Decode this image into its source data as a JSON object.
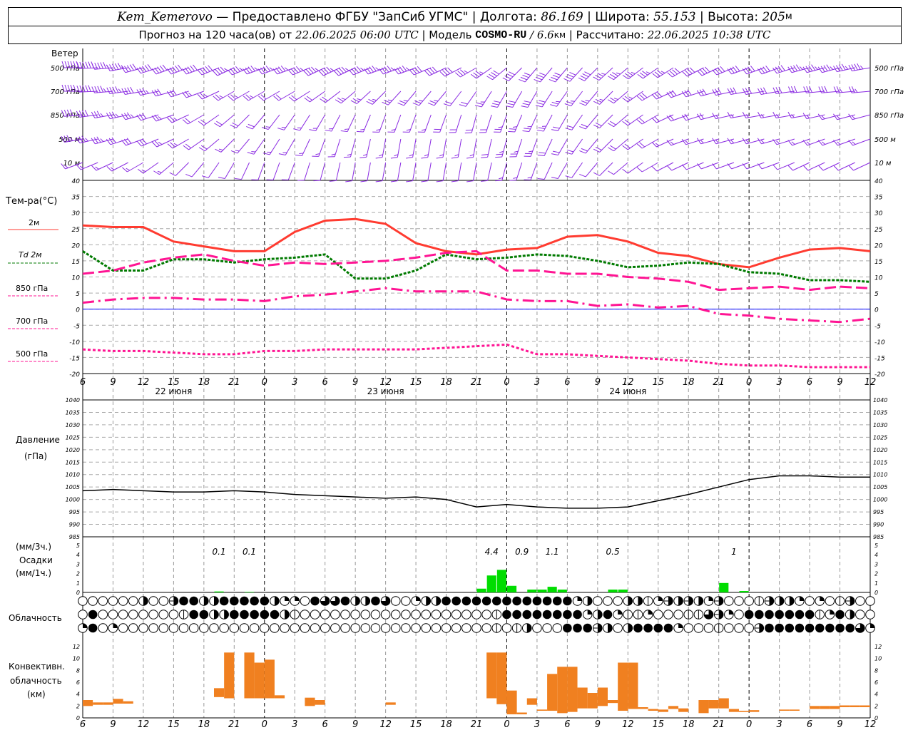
{
  "header": {
    "station": "Kem_Kemerovo",
    "provided": " — Предоставлено ФГБУ \"ЗапСиб УГМС\" | Долгота: ",
    "lon": "86.169",
    "lat_label": " | Широта: ",
    "lat": "55.153",
    "alt_label": " | Высота: ",
    "alt": "205",
    "alt_unit": "м",
    "forecast_label": "Прогноз на 120 часа(ов) от ",
    "forecast_time": "22.06.2025 06:00 UTC",
    "model_label": " | Модель ",
    "model": "COSMO-RU",
    "model_res": " / 6.6",
    "res_unit": "км",
    "calc_label": " | Рассчитано: ",
    "calc_time": "22.06.2025 10:38 UTC"
  },
  "labels": {
    "wind": "Ветер",
    "wind_levels": [
      "500 гПа",
      "700 гПа",
      "850 гПа",
      "500 м",
      "10 м"
    ],
    "temp": "Тем-ра(°C)",
    "t2m": "2м",
    "td": "Td  2м",
    "t850": "850 гПа",
    "t700": "700 гПа",
    "t500": "500 гПа",
    "pressure": "Давление",
    "pressure_unit": "(гПа)",
    "precip_unit3": "(мм/3ч.)",
    "precip": "Осадки",
    "precip_unit1": "(мм/1ч.)",
    "cloud": "Облачность",
    "conv1": "Конвективн.",
    "conv2": "облачность",
    "conv3": "(км)"
  },
  "colors": {
    "t2m": "#ff3b30",
    "td": "#007a00",
    "levels": "#ff1493",
    "wind": "#8a2be2",
    "precip": "#00dd00",
    "conv": "#f08020",
    "zero": "#0000ff"
  },
  "chart_data": {
    "type": "line",
    "x_hours_from_start": [
      0,
      3,
      6,
      9,
      12,
      15,
      18,
      21,
      24,
      27,
      30,
      33,
      36,
      39,
      42,
      45,
      48,
      51,
      54,
      57,
      60,
      63,
      66,
      69,
      72,
      75,
      78
    ],
    "x_tick_labels": [
      "6",
      "9",
      "12",
      "15",
      "18",
      "21",
      "0",
      "3",
      "6",
      "9",
      "12",
      "15",
      "18",
      "21",
      "0",
      "3",
      "6",
      "9",
      "12",
      "15",
      "18",
      "21",
      "0",
      "3",
      "6",
      "9",
      "12"
    ],
    "day_labels": [
      {
        "label": "22 июня",
        "hour": 9
      },
      {
        "label": "23 июня",
        "hour": 30
      },
      {
        "label": "24 июня",
        "hour": 54
      }
    ],
    "temperature": {
      "ylim": [
        -20,
        40
      ],
      "yticks": [
        40,
        35,
        30,
        25,
        20,
        15,
        10,
        5,
        0,
        -5,
        -10,
        -15,
        -20
      ],
      "series": [
        {
          "name": "2м",
          "key": "t2m",
          "values": [
            26,
            25.5,
            25.5,
            21,
            19.5,
            18,
            18,
            24,
            27.5,
            28,
            26.5,
            20.5,
            18,
            17,
            18.5,
            19,
            22.5,
            23,
            21,
            17.5,
            16.5,
            14,
            13,
            16,
            18.5,
            19,
            18
          ]
        },
        {
          "name": "Td 2м",
          "key": "td",
          "values": [
            18,
            12,
            12,
            15.5,
            15.5,
            14.5,
            15.5,
            16,
            17,
            9.5,
            9.5,
            12,
            17,
            15.5,
            16,
            17,
            16.5,
            15,
            13,
            13.5,
            14.5,
            14,
            11.5,
            11,
            9,
            9,
            8.5
          ]
        },
        {
          "name": "850 гПа",
          "key": "t850",
          "values": [
            11,
            12,
            14.5,
            16,
            17,
            15,
            13.5,
            14.5,
            14,
            14.5,
            15,
            16,
            17.5,
            18,
            12,
            12,
            11,
            11,
            10,
            9.5,
            8.5,
            6,
            6.5,
            7,
            6,
            7,
            6.5
          ]
        },
        {
          "name": "700 гПа",
          "key": "t700",
          "values": [
            2,
            3,
            3.5,
            3.5,
            3,
            3,
            2.5,
            4,
            4.5,
            5.5,
            6.5,
            5.5,
            5.5,
            5.5,
            3,
            2.5,
            2.5,
            1,
            1.5,
            0.5,
            1,
            -1.5,
            -2,
            -3,
            -3.5,
            -4,
            -3
          ]
        },
        {
          "name": "500 гПа",
          "key": "t500",
          "values": [
            -12.5,
            -13,
            -13,
            -13.5,
            -14,
            -14,
            -13,
            -13,
            -12.5,
            -12.5,
            -12.5,
            -12.5,
            -12,
            -11.5,
            -11,
            -14,
            -14,
            -14.5,
            -15,
            -15.5,
            -16,
            -17,
            -17.5,
            -17.5,
            -18,
            -18,
            -18
          ]
        }
      ]
    },
    "pressure": {
      "ylim": [
        985,
        1040
      ],
      "yticks": [
        1040,
        1035,
        1030,
        1025,
        1020,
        1015,
        1010,
        1005,
        1000,
        995,
        990,
        985
      ],
      "values": [
        1003.5,
        1004,
        1003.5,
        1003,
        1003,
        1003.5,
        1003,
        1002,
        1001.5,
        1001,
        1000.5,
        1001,
        1000,
        997,
        998,
        997,
        996.5,
        996.5,
        997,
        999.5,
        1002,
        1005,
        1008,
        1009.5,
        1009.5,
        1009,
        1009
      ]
    },
    "precipitation": {
      "ylim": [
        0,
        5
      ],
      "yticks": [
        5,
        4,
        3,
        2,
        1,
        0
      ],
      "hourly": [
        {
          "h": 13,
          "v": 0.1
        },
        {
          "h": 16,
          "v": 0.05
        },
        {
          "h": 39,
          "v": 0.4
        },
        {
          "h": 40,
          "v": 1.8
        },
        {
          "h": 41,
          "v": 2.4
        },
        {
          "h": 42,
          "v": 0.7
        },
        {
          "h": 44,
          "v": 0.3
        },
        {
          "h": 45,
          "v": 0.3
        },
        {
          "h": 46,
          "v": 0.6
        },
        {
          "h": 47,
          "v": 0.3
        },
        {
          "h": 52,
          "v": 0.3
        },
        {
          "h": 53,
          "v": 0.3
        },
        {
          "h": 63,
          "v": 1.0
        },
        {
          "h": 65,
          "v": 0.15
        }
      ],
      "totals_3h": [
        {
          "h": 13.5,
          "label": "0.1"
        },
        {
          "h": 16.5,
          "label": "0.1"
        },
        {
          "h": 40.5,
          "label": "4.4"
        },
        {
          "h": 43.5,
          "label": "0.9"
        },
        {
          "h": 46.5,
          "label": "1.1"
        },
        {
          "h": 52.5,
          "label": "0.5"
        },
        {
          "h": 64.5,
          "label": "1"
        }
      ]
    },
    "cloudiness": {
      "legend": "0=clear 1=quarter 2=half 3=three-quarter 4=overcast i=trace h=obscured",
      "rows": [
        "",
        "",
        ""
      ]
    },
    "convective": {
      "ylim": [
        0,
        12
      ],
      "yticks": [
        12,
        10,
        8,
        6,
        4,
        2,
        0
      ],
      "bars": [
        [
          0,
          2,
          3
        ],
        [
          1,
          2.2,
          2.6
        ],
        [
          2,
          2.2,
          2.6
        ],
        [
          3,
          2.4,
          3.2
        ],
        [
          4,
          2.4,
          2.8
        ],
        [
          13,
          3.5,
          5
        ],
        [
          14,
          3.3,
          11
        ],
        [
          16,
          3.3,
          11
        ],
        [
          17,
          3.3,
          9.3
        ],
        [
          18,
          3.3,
          9.8
        ],
        [
          19,
          3.3,
          3.8
        ],
        [
          22,
          2,
          3.4
        ],
        [
          23,
          2.2,
          3
        ],
        [
          30,
          2.2,
          2.6
        ],
        [
          40,
          3.3,
          11
        ],
        [
          41,
          2.3,
          11
        ],
        [
          42,
          0.6,
          4.6
        ],
        [
          43,
          0.6,
          0.9
        ],
        [
          44,
          2.2,
          3.3
        ],
        [
          45,
          1.2,
          1.4
        ],
        [
          46,
          1.2,
          7.4
        ],
        [
          47,
          0.8,
          8.6
        ],
        [
          48,
          1,
          8.6
        ],
        [
          49,
          1.6,
          5.1
        ],
        [
          50,
          1.6,
          4.2
        ],
        [
          51,
          2,
          5.1
        ],
        [
          52,
          2.5,
          3
        ],
        [
          53,
          1.2,
          9.3
        ],
        [
          54,
          1.5,
          9.3
        ],
        [
          55,
          1.5,
          1.8
        ],
        [
          56,
          1.2,
          1.5
        ],
        [
          57,
          1,
          1.4
        ],
        [
          58,
          1.5,
          2
        ],
        [
          59,
          1,
          1.6
        ],
        [
          61,
          0.8,
          3
        ],
        [
          62,
          1.6,
          3
        ],
        [
          63,
          1.6,
          3.3
        ],
        [
          64,
          1,
          1.5
        ],
        [
          65,
          1,
          1.2
        ],
        [
          66,
          1,
          1.3
        ],
        [
          69,
          1.2,
          1.4
        ],
        [
          70,
          1.2,
          1.4
        ],
        [
          72,
          1.5,
          2
        ],
        [
          73,
          1.5,
          2
        ],
        [
          74,
          1.5,
          2
        ],
        [
          75,
          1.8,
          2.1
        ],
        [
          76,
          1.8,
          2.1
        ],
        [
          77,
          1.8,
          2.1
        ]
      ]
    },
    "wind": {
      "levels": [
        {
          "name": "500 гПа",
          "dir": [
            270,
            265,
            255,
            250,
            250,
            245,
            250,
            250,
            245,
            245,
            250,
            250,
            245,
            240,
            230,
            220,
            220,
            225,
            230,
            235,
            240,
            245,
            250,
            250,
            255,
            255,
            260
          ],
          "speed": [
            24,
            22,
            20,
            20,
            20,
            18,
            18,
            18,
            18,
            18,
            18,
            17,
            16,
            14,
            15,
            16,
            15,
            15,
            14,
            14,
            15,
            15,
            16,
            16,
            17,
            17,
            18
          ]
        },
        {
          "name": "700 гПа",
          "dir": [
            270,
            265,
            260,
            255,
            250,
            240,
            240,
            240,
            235,
            230,
            225,
            220,
            220,
            215,
            210,
            210,
            215,
            220,
            230,
            240,
            250,
            255,
            260,
            260,
            265,
            265,
            265
          ],
          "speed": [
            20,
            18,
            16,
            12,
            10,
            9,
            9,
            8,
            8,
            9,
            10,
            10,
            9,
            8,
            12,
            12,
            10,
            10,
            10,
            11,
            12,
            12,
            12,
            12,
            11,
            11,
            10
          ]
        },
        {
          "name": "850 гПа",
          "dir": [
            265,
            260,
            255,
            250,
            240,
            230,
            220,
            215,
            210,
            205,
            200,
            200,
            200,
            195,
            200,
            205,
            210,
            220,
            230,
            240,
            250,
            255,
            260,
            260,
            260,
            255,
            255
          ],
          "speed": [
            16,
            14,
            13,
            10,
            8,
            7,
            7,
            6,
            6,
            6,
            6,
            6,
            7,
            7,
            10,
            10,
            8,
            8,
            8,
            8,
            7,
            7,
            6,
            6,
            6,
            6,
            6
          ]
        },
        {
          "name": "500 м",
          "dir": [
            260,
            255,
            250,
            245,
            235,
            225,
            215,
            210,
            200,
            195,
            190,
            190,
            190,
            190,
            195,
            200,
            210,
            220,
            230,
            240,
            250,
            255,
            255,
            255,
            250,
            250,
            250
          ],
          "speed": [
            14,
            13,
            12,
            10,
            8,
            6,
            6,
            5,
            5,
            5,
            5,
            6,
            6,
            6,
            9,
            9,
            7,
            7,
            7,
            7,
            6,
            6,
            5,
            5,
            5,
            5,
            5
          ]
        },
        {
          "name": "10 м",
          "dir": [
            250,
            245,
            240,
            230,
            220,
            210,
            200,
            200,
            195,
            190,
            190,
            190,
            190,
            190,
            195,
            200,
            210,
            220,
            230,
            240,
            245,
            250,
            250,
            250,
            245,
            245,
            245
          ],
          "speed": [
            6,
            6,
            5,
            5,
            4,
            4,
            3,
            3,
            3,
            3,
            3,
            3,
            4,
            4,
            5,
            5,
            4,
            4,
            4,
            4,
            4,
            3,
            3,
            3,
            3,
            3,
            3
          ]
        }
      ]
    }
  },
  "cloud_rows": [
    "0000002 00h4422444442110433422430012244444444444441200022i1h2h21h000ih221010ih",
    "04000000 00i4422444442i0000000000000000000i444444441241ii1000ii3h104444444i14200121i00",
    "14010000000000000000000000000000000000000i0i2000444h20244441000i000h4444444443111i10000"
  ]
}
